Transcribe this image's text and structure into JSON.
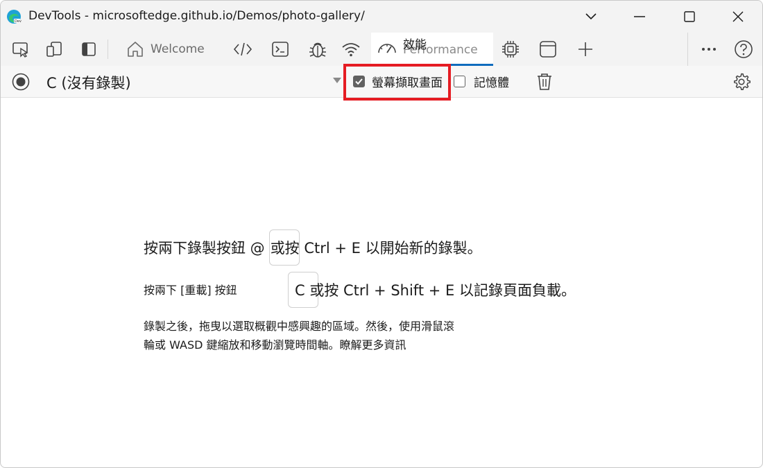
{
  "window": {
    "title": "DevTools - microsoftedge.github.io/Demos/photo-gallery/"
  },
  "tabs": {
    "welcome_label": "Welcome",
    "performance_ghost_label": "Performance",
    "performance_label": "效能"
  },
  "toolbar": {
    "recording_label": "C (沒有錄製)",
    "screenshots_label": "螢幕擷取畫面",
    "screenshots_checked": true,
    "memory_label": "記憶體",
    "memory_checked": false
  },
  "content": {
    "line1_part1": "按兩下錄製按鈕 @",
    "line1_part2": "或按 Ctrl + E 以開始新的錄製。",
    "line2_left": "按兩下 [重載] 按鈕",
    "line2_right": "C 或按 Ctrl + Shift + E 以記錄頁面負載。",
    "para_line1": "錄製之後，拖曳以選取概觀中感興趣的區域。然後，使用滑鼠滾",
    "para_line2": "輪或 WASD 鍵縮放和移動瀏覽時間軸。瞭解更多資訊"
  },
  "colors": {
    "accent": "#0f6cbd",
    "highlight": "#e51c23",
    "chrome_bg": "#f3f3f3"
  },
  "icons": [
    "edge-logo-icon",
    "inspect-icon",
    "device-emulation-icon",
    "dock-icon",
    "home-icon",
    "elements-icon",
    "console-icon",
    "sources-bug-icon",
    "network-wifi-icon",
    "performance-gauge-icon",
    "memory-chip-icon",
    "application-icon",
    "add-tab-icon",
    "more-icon",
    "help-icon",
    "record-icon",
    "dropdown-caret-icon",
    "trash-icon",
    "settings-gear-icon"
  ]
}
